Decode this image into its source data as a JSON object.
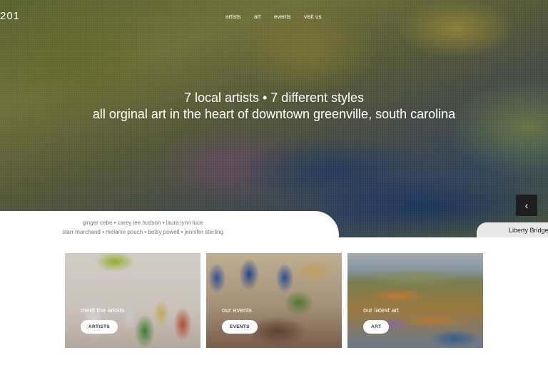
{
  "header": {
    "logo_fragment": "201",
    "nav": [
      "artists",
      "art",
      "events",
      "visit us"
    ]
  },
  "hero": {
    "line1": "7 local artists • 7 different styles",
    "line2": "all orginal art in the heart of downtown greenville, south carolina",
    "prev_icon": "‹",
    "caption": "Liberty Bridge"
  },
  "artists": {
    "row1": "ginger cebe • carey lee hudson • laura lynn luce",
    "row2": "starr marchand • melanie pouch • betsy powell • jennifer sterling"
  },
  "cards": [
    {
      "title": "meet the artists",
      "button": "ARTISTS"
    },
    {
      "title": "our events",
      "button": "EVENTS"
    },
    {
      "title": "our latest art",
      "button": "ART"
    }
  ]
}
